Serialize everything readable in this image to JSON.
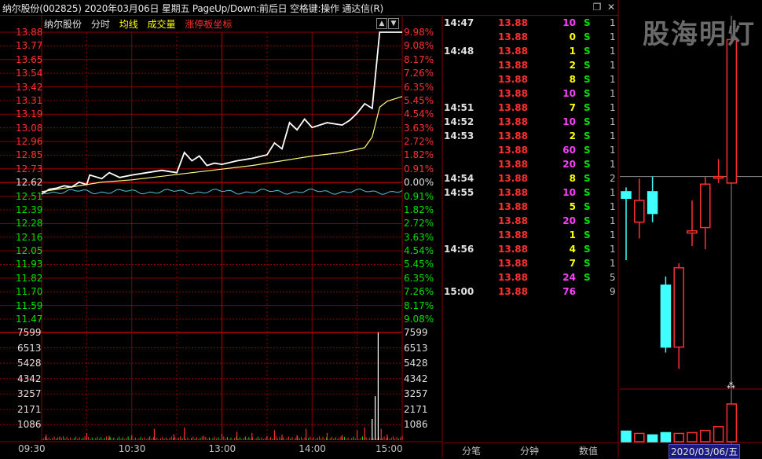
{
  "window": {
    "title": "纳尔股份(002825)  2020年03月06日 星期五 PageUp/Down:前后日 空格键:操作 通达信(R)",
    "max_icon": "restore-icon",
    "close_icon": "close-icon"
  },
  "legend": {
    "name": "纳尔股份",
    "fenshi": "分时",
    "avg": "均线",
    "vol": "成交量",
    "zt": "涨停板坐标"
  },
  "colors": {
    "grid": "#8b0000",
    "up": "#ff3030",
    "down": "#00e000",
    "price_line": "#ffffff",
    "avg_line": "#ffff80",
    "buy_ratio_line": "#4ec8d8",
    "vol_magenta": "#ff40ff",
    "vol_yellow": "#ffff00",
    "k_up": "#ff3030",
    "k_down": "#40ffff"
  },
  "chart_data": {
    "type": "line",
    "title": "纳尔股份 分时",
    "prev_close": 12.62,
    "price_ticks": [
      13.88,
      13.77,
      13.65,
      13.54,
      13.42,
      13.31,
      13.19,
      13.08,
      12.96,
      12.85,
      12.73,
      12.62,
      12.51,
      12.39,
      12.28,
      12.16,
      12.05,
      11.93,
      11.82,
      11.7,
      11.59,
      11.47
    ],
    "pct_ticks": [
      "9.98%",
      "9.08%",
      "8.17%",
      "7.26%",
      "6.35%",
      "5.45%",
      "4.54%",
      "3.63%",
      "2.72%",
      "1.82%",
      "0.91%",
      "0.00%",
      "0.91%",
      "1.82%",
      "2.72%",
      "3.63%",
      "4.54%",
      "5.45%",
      "6.35%",
      "7.26%",
      "8.17%",
      "9.08%"
    ],
    "volume_ticks": [
      7599,
      6513,
      5428,
      4342,
      3257,
      2171,
      1086
    ],
    "time_ticks": [
      "09:30",
      "10:30",
      "13:00",
      "14:00",
      "15:00"
    ],
    "price_series": [
      [
        0,
        12.52
      ],
      [
        5,
        12.56
      ],
      [
        10,
        12.57
      ],
      [
        15,
        12.59
      ],
      [
        20,
        12.58
      ],
      [
        25,
        12.62
      ],
      [
        30,
        12.6
      ],
      [
        32,
        12.68
      ],
      [
        40,
        12.65
      ],
      [
        45,
        12.7
      ],
      [
        52,
        12.66
      ],
      [
        60,
        12.68
      ],
      [
        70,
        12.7
      ],
      [
        80,
        12.72
      ],
      [
        90,
        12.7
      ],
      [
        95,
        12.87
      ],
      [
        100,
        12.8
      ],
      [
        105,
        12.84
      ],
      [
        110,
        12.76
      ],
      [
        115,
        12.78
      ],
      [
        120,
        12.77
      ],
      [
        130,
        12.8
      ],
      [
        140,
        12.82
      ],
      [
        150,
        12.85
      ],
      [
        155,
        12.95
      ],
      [
        160,
        12.9
      ],
      [
        165,
        13.12
      ],
      [
        170,
        13.06
      ],
      [
        175,
        13.15
      ],
      [
        180,
        13.08
      ],
      [
        190,
        13.12
      ],
      [
        200,
        13.1
      ],
      [
        205,
        13.14
      ],
      [
        210,
        13.2
      ],
      [
        215,
        13.28
      ],
      [
        220,
        13.24
      ],
      [
        225,
        13.88
      ],
      [
        230,
        13.88
      ],
      [
        240,
        13.88
      ]
    ],
    "avg_series": [
      [
        0,
        12.54
      ],
      [
        20,
        12.58
      ],
      [
        40,
        12.62
      ],
      [
        60,
        12.64
      ],
      [
        80,
        12.67
      ],
      [
        100,
        12.7
      ],
      [
        120,
        12.73
      ],
      [
        140,
        12.76
      ],
      [
        160,
        12.8
      ],
      [
        180,
        12.84
      ],
      [
        200,
        12.87
      ],
      [
        215,
        12.91
      ],
      [
        220,
        13.0
      ],
      [
        225,
        13.25
      ],
      [
        230,
        13.3
      ],
      [
        240,
        13.34
      ]
    ],
    "volume_bars": [
      [
        3,
        400
      ],
      [
        12,
        250
      ],
      [
        30,
        500
      ],
      [
        45,
        300
      ],
      [
        60,
        350
      ],
      [
        75,
        800
      ],
      [
        88,
        420
      ],
      [
        95,
        900
      ],
      [
        108,
        300
      ],
      [
        120,
        450
      ],
      [
        130,
        600
      ],
      [
        140,
        500
      ],
      [
        150,
        300
      ],
      [
        155,
        700
      ],
      [
        160,
        400
      ],
      [
        170,
        350
      ],
      [
        176,
        800
      ],
      [
        190,
        500
      ],
      [
        200,
        350
      ],
      [
        210,
        700
      ],
      [
        215,
        900
      ],
      [
        220,
        1500
      ],
      [
        222,
        3100
      ],
      [
        224,
        7599
      ],
      [
        226,
        800
      ],
      [
        230,
        400
      ],
      [
        240,
        300
      ]
    ]
  },
  "ticks_table": [
    {
      "time": "14:47",
      "price": "13.88",
      "vol": "10",
      "vol_color": "#ff40ff",
      "bs": "S",
      "n": "1"
    },
    {
      "time": "",
      "price": "13.88",
      "vol": "0",
      "vol_color": "#ffff00",
      "bs": "S",
      "n": "1"
    },
    {
      "time": "14:48",
      "price": "13.88",
      "vol": "1",
      "vol_color": "#ffff00",
      "bs": "S",
      "n": "1"
    },
    {
      "time": "",
      "price": "13.88",
      "vol": "2",
      "vol_color": "#ffff00",
      "bs": "S",
      "n": "1"
    },
    {
      "time": "",
      "price": "13.88",
      "vol": "8",
      "vol_color": "#ffff00",
      "bs": "S",
      "n": "1"
    },
    {
      "time": "",
      "price": "13.88",
      "vol": "10",
      "vol_color": "#ff40ff",
      "bs": "S",
      "n": "1"
    },
    {
      "time": "14:51",
      "price": "13.88",
      "vol": "7",
      "vol_color": "#ffff00",
      "bs": "S",
      "n": "1"
    },
    {
      "time": "14:52",
      "price": "13.88",
      "vol": "10",
      "vol_color": "#ff40ff",
      "bs": "S",
      "n": "1"
    },
    {
      "time": "14:53",
      "price": "13.88",
      "vol": "2",
      "vol_color": "#ffff00",
      "bs": "S",
      "n": "1"
    },
    {
      "time": "",
      "price": "13.88",
      "vol": "60",
      "vol_color": "#ff40ff",
      "bs": "S",
      "n": "1"
    },
    {
      "time": "",
      "price": "13.88",
      "vol": "20",
      "vol_color": "#ff40ff",
      "bs": "S",
      "n": "1"
    },
    {
      "time": "14:54",
      "price": "13.88",
      "vol": "8",
      "vol_color": "#ffff00",
      "bs": "S",
      "n": "2"
    },
    {
      "time": "14:55",
      "price": "13.88",
      "vol": "10",
      "vol_color": "#ff40ff",
      "bs": "S",
      "n": "1"
    },
    {
      "time": "",
      "price": "13.88",
      "vol": "5",
      "vol_color": "#ffff00",
      "bs": "S",
      "n": "1"
    },
    {
      "time": "",
      "price": "13.88",
      "vol": "20",
      "vol_color": "#ff40ff",
      "bs": "S",
      "n": "1"
    },
    {
      "time": "",
      "price": "13.88",
      "vol": "1",
      "vol_color": "#ffff00",
      "bs": "S",
      "n": "1"
    },
    {
      "time": "14:56",
      "price": "13.88",
      "vol": "4",
      "vol_color": "#ffff00",
      "bs": "S",
      "n": "1"
    },
    {
      "time": "",
      "price": "13.88",
      "vol": "7",
      "vol_color": "#ffff00",
      "bs": "S",
      "n": "1"
    },
    {
      "time": "",
      "price": "13.88",
      "vol": "24",
      "vol_color": "#ff40ff",
      "bs": "S",
      "n": "5"
    },
    {
      "time": "15:00",
      "price": "13.88",
      "vol": "76",
      "vol_color": "#ff40ff",
      "bs": "",
      "n": "9"
    }
  ],
  "tabs": [
    "分笔",
    "分钟",
    "数值"
  ],
  "watermark": "股海明灯",
  "kline": {
    "date_label": "2020/03/06/五",
    "candles": [
      {
        "o": 12.48,
        "c": 12.42,
        "h": 12.52,
        "l": 11.85
      },
      {
        "o": 12.2,
        "c": 12.4,
        "h": 12.6,
        "l": 12.05
      },
      {
        "o": 12.48,
        "c": 12.28,
        "h": 12.62,
        "l": 12.2
      },
      {
        "o": 11.62,
        "c": 11.05,
        "h": 11.7,
        "l": 11.0
      },
      {
        "o": 11.05,
        "c": 11.78,
        "h": 11.82,
        "l": 10.85
      },
      {
        "o": 12.1,
        "c": 12.12,
        "h": 12.4,
        "l": 11.98
      },
      {
        "o": 12.15,
        "c": 12.55,
        "h": 12.62,
        "l": 11.95
      },
      {
        "o": 12.62,
        "c": 12.62,
        "h": 12.78,
        "l": 12.56
      },
      {
        "o": 12.56,
        "c": 13.88,
        "h": 13.88,
        "l": 12.56
      }
    ],
    "volumes": [
      0.28,
      0.22,
      0.18,
      0.24,
      0.22,
      0.24,
      0.3,
      0.4,
      1.0
    ]
  }
}
